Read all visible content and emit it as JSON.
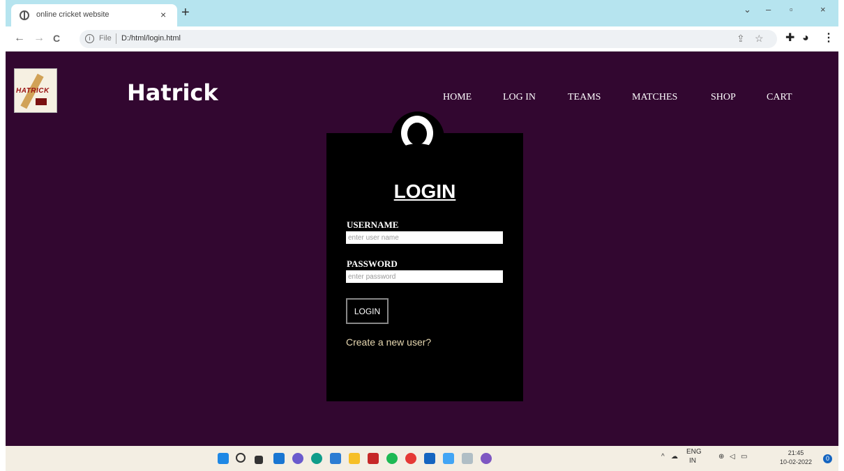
{
  "browser": {
    "tab_title": "online cricket website",
    "tab_close": "×",
    "new_tab": "+",
    "window_controls": {
      "chevron": "⌄",
      "minimize": "–",
      "restore": "▫",
      "close": "×"
    },
    "nav": {
      "back": "←",
      "forward": "→",
      "reload": "C"
    },
    "address": {
      "scheme": "File",
      "url": "D:/html/login.html"
    },
    "icons": [
      "share-icon",
      "star-icon",
      "extensions-icon",
      "profile-icon",
      "menu-icon"
    ]
  },
  "site": {
    "brand": "Hatrick",
    "logo_text": "HATRICK",
    "nav_items": [
      "HOME",
      "LOG IN",
      "TEAMS",
      "MATCHES",
      "SHOP",
      "CART"
    ],
    "background_color": "#320730"
  },
  "login": {
    "title": "LOGIN",
    "username_label": "USERNAME",
    "username_placeholder": "enter user name",
    "password_label": "PASSWORD",
    "password_placeholder": "enter password",
    "button_label": "LOGIN",
    "create_link": "Create a new user?"
  },
  "taskbar": {
    "apps": [
      "start-icon",
      "search-icon",
      "taskview-icon",
      "widgets-icon",
      "chat-icon",
      "edge-icon",
      "store-icon",
      "explorer-icon",
      "mcafee-icon",
      "spotify-icon",
      "chrome-icon",
      "mail-icon",
      "notepad-icon",
      "wordpad-icon",
      "photos-icon"
    ],
    "tray_language": "ENG",
    "tray_region": "IN",
    "time": "21:45",
    "date": "10-02-2022",
    "notification_count": "0"
  }
}
